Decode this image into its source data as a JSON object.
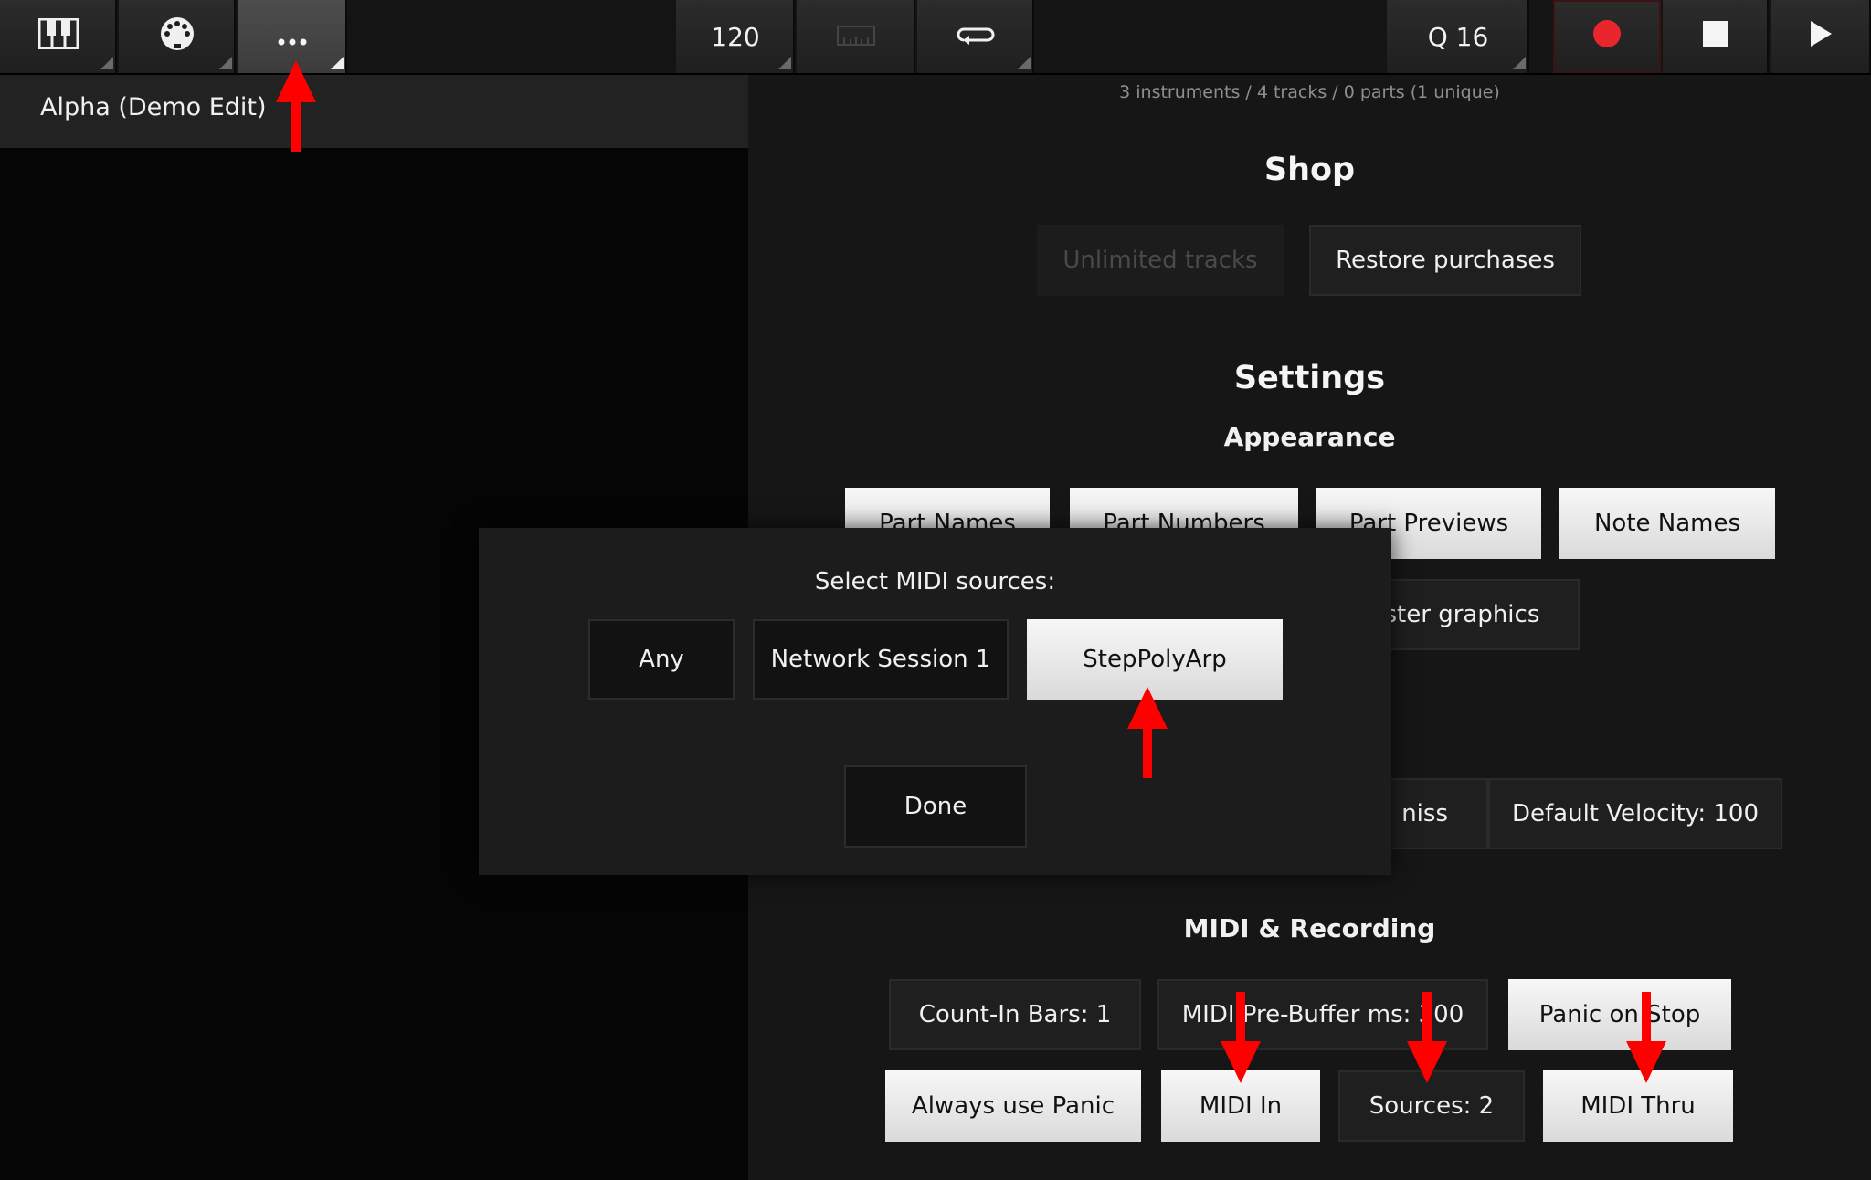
{
  "toolbar": {
    "tempo": "120",
    "quantize": "Q 16",
    "colors": {
      "record": "#e8262b",
      "active_bg": "#454545"
    }
  },
  "song": {
    "title": "Alpha (Demo Edit)"
  },
  "panel": {
    "stats": "3 instruments / 4 tracks / 0 parts (1 unique)",
    "shop": {
      "heading": "Shop",
      "unlimited_tracks": "Unlimited tracks",
      "restore_purchases": "Restore purchases"
    },
    "settings": {
      "heading": "Settings",
      "appearance": {
        "heading": "Appearance",
        "part_names": "Part Names",
        "part_numbers": "Part Numbers",
        "part_previews": "Part Previews",
        "note_names": "Note Names",
        "faster_graphics": "Faster graphics"
      },
      "editing": {
        "dismiss_partial": "niss",
        "default_velocity": "Default Velocity: 100"
      },
      "midi": {
        "heading": "MIDI & Recording",
        "count_in": "Count-In Bars: 1",
        "pre_buffer": "MIDI Pre-Buffer ms: 300",
        "panic_on_stop": "Panic on Stop",
        "always_use_panic": "Always use Panic",
        "midi_in": "MIDI In",
        "sources": "Sources: 2",
        "midi_thru": "MIDI Thru"
      }
    }
  },
  "dialog": {
    "title": "Select MIDI sources:",
    "options": [
      "Any",
      "Network Session 1",
      "StepPolyArp"
    ],
    "selected": "StepPolyArp",
    "done": "Done"
  },
  "annotations": {
    "arrow_color": "#ff0000"
  }
}
